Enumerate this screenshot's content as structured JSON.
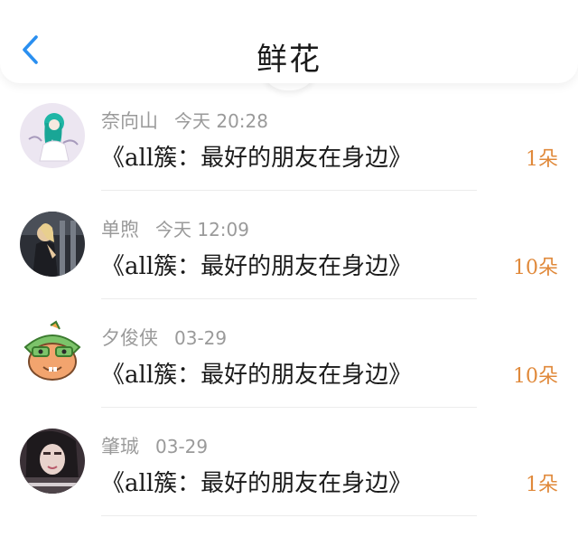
{
  "header": {
    "title": "鲜花",
    "back_icon": "chevron-left-icon",
    "accent": "#2a8ff0"
  },
  "items": [
    {
      "user": "奈向山",
      "time": "今天 20:28",
      "work": "《all簇：最好的朋友在身边》",
      "count": "1朵"
    },
    {
      "user": "单煦",
      "time": "今天 12:09",
      "work": "《all簇：最好的朋友在身边》",
      "count": "10朵"
    },
    {
      "user": "夕俊侠",
      "time": "03-29",
      "work": "《all簇：最好的朋友在身边》",
      "count": "10朵"
    },
    {
      "user": "肇珹",
      "time": "03-29",
      "work": "《all簇：最好的朋友在身边》",
      "count": "1朵"
    }
  ],
  "colors": {
    "count": "#e0893a",
    "meta": "#9a9a9a",
    "text": "#1a1a1a"
  }
}
